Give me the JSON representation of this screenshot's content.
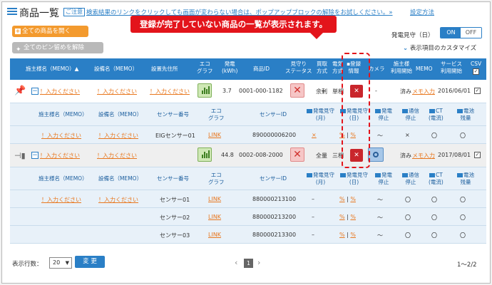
{
  "page": {
    "title": "商品一覧",
    "notice_badge": "ご注意",
    "notice_text": "検索結果のリンクをクリックしても画面が変わらない場合は、ポップアップブロックの解除をお試しください。»",
    "notice_link": "設定方法"
  },
  "toolbar": {
    "open_all": "全ての商品を開く",
    "unpin_all": "全てのピン留めを解除",
    "hatsuden_label": "発電見守（日）",
    "toggle_on": "ON",
    "toggle_off": "OFF",
    "customize": "表示項目のカスタマイズ"
  },
  "callout": "登録が完了していない商品の一覧が表示されます。",
  "columns": {
    "plant": "施主様名（MEMO）▲",
    "equip": "設備名（MEMO）",
    "site": "設置先住所",
    "eco1": "エコ",
    "eco2": "グラフ",
    "power1": "発電",
    "power2": "(kWh)",
    "product_id": "商品ID",
    "watch1": "見守り",
    "watch2": "ステータス",
    "buy1": "買取",
    "buy2": "方式",
    "elec1": "電気",
    "elec2": "方式",
    "reg1": "登録",
    "reg2": "情報",
    "camera": "カメラ",
    "start1": "施主様",
    "start2": "利用開始",
    "memo": "MEMO",
    "service1": "サービス",
    "service2": "利用開始",
    "csv": "CSV"
  },
  "products": [
    {
      "plant": "！入力ください",
      "equip": "！入力ください",
      "site": "！入力ください",
      "power": "3.7",
      "product_id": "0001-000-1182",
      "buy": "余剰",
      "elec": "単相",
      "camera": "-",
      "start": "済み",
      "memo": "メモ入力",
      "service": "2016/06/01"
    },
    {
      "plant": "！入力ください",
      "equip": "！入力ください",
      "site": "",
      "power": "44.8",
      "product_id": "0002-008-2000",
      "buy": "全量",
      "elec": "三相",
      "camera": "",
      "start": "済み",
      "memo": "メモ入力",
      "service": "2017/08/01"
    }
  ],
  "sub_columns": {
    "plant": "施主様名（MEMO）",
    "equip": "設備名（MEMO）",
    "sensor_no": "センサー番号",
    "eco1": "エコ",
    "eco2": "グラフ",
    "sensor_id": "センサーID",
    "month1": "発電見守",
    "month2": "(月)",
    "day1": "発電見守",
    "day2": "(日)",
    "stop1": "発電",
    "stop2": "停止",
    "comm1": "通信",
    "comm2": "停止",
    "ct1": "CT",
    "ct2": "(電流)",
    "batt1": "電池",
    "batt2": "残量"
  },
  "sensors_1": [
    {
      "plant": "！入力ください",
      "equip": "！入力ください",
      "sensor_no": "EIGセンサー01",
      "eco": "LINK",
      "sensor_id": "890000006200",
      "month": "×",
      "day_a": "%",
      "day_b": "%",
      "stop": "〜",
      "comm": "×",
      "ct": "〇",
      "batt": "〇"
    }
  ],
  "sensors_2": [
    {
      "plant": "！入力ください",
      "equip": "！入力ください",
      "sensor_no": "センサー01",
      "eco": "LINK",
      "sensor_id": "880000213100",
      "month": "–",
      "day_a": "%",
      "day_b": "%",
      "stop": "〜",
      "comm": "〇",
      "ct": "〇",
      "batt": "〇"
    },
    {
      "sensor_no": "センサー02",
      "eco": "LINK",
      "sensor_id": "880000213200",
      "month": "–",
      "day_a": "%",
      "day_b": "%",
      "stop": "〜",
      "comm": "〇",
      "ct": "〇",
      "batt": "〇"
    },
    {
      "sensor_no": "センサー03",
      "eco": "LINK",
      "sensor_id": "880000213300",
      "month": "–",
      "day_a": "%",
      "day_b": "%",
      "stop": "〜",
      "comm": "〇",
      "ct": "〇",
      "batt": "〇"
    }
  ],
  "footer": {
    "rows_label": "表示行数：",
    "rows_value": "20",
    "change_button": "変 更",
    "prev": "‹",
    "page": "1",
    "next": "›",
    "range": "1〜2/2"
  }
}
